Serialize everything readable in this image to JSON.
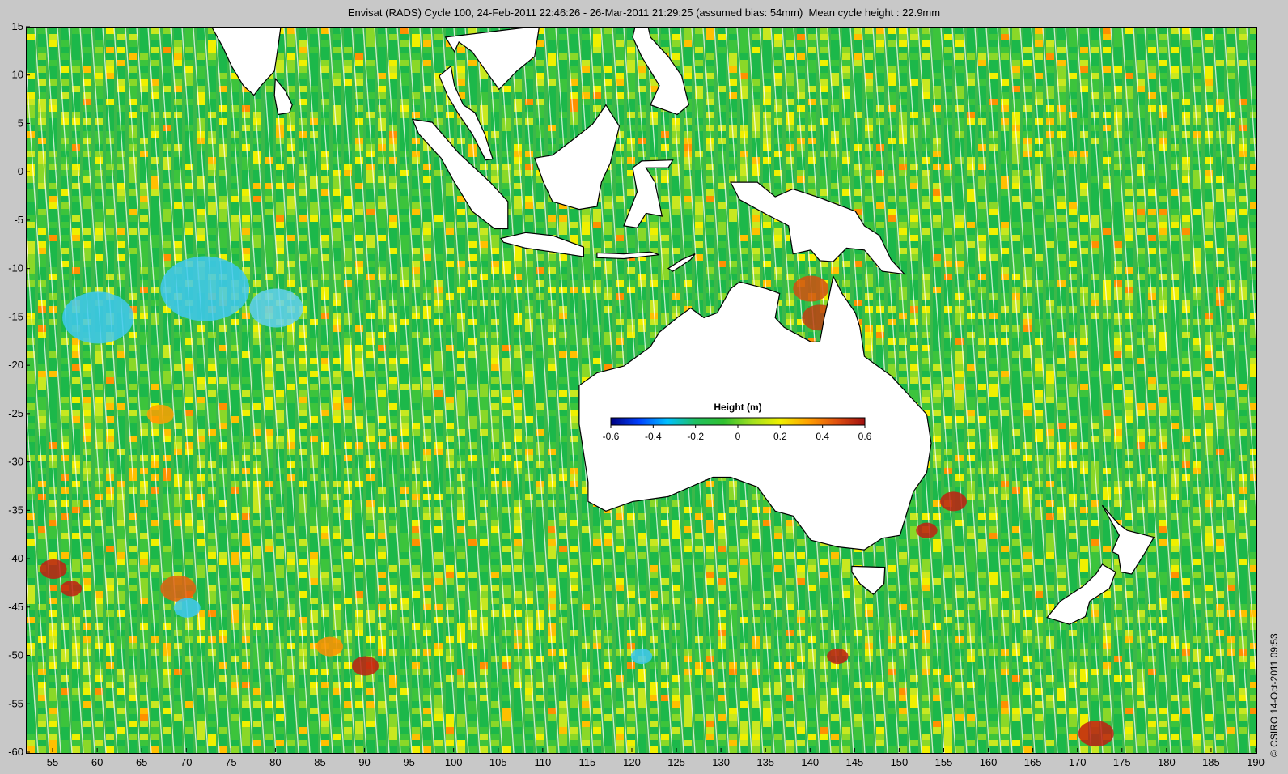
{
  "title": "Envisat (RADS) Cycle 100, 24-Feb-2011 22:46:26 - 26-Mar-2011 21:29:25 (assumed bias: 54mm)  Mean cycle height : 22.9mm",
  "copyright": "© CSIRO 14-Oct-2011 09:53",
  "axes": {
    "lon_min": 52,
    "lon_max": 190,
    "lat_min": -60,
    "lat_max": 15,
    "x_ticks": [
      55,
      60,
      65,
      70,
      75,
      80,
      85,
      90,
      95,
      100,
      105,
      110,
      115,
      120,
      125,
      130,
      135,
      140,
      145,
      150,
      155,
      160,
      165,
      170,
      175,
      180,
      185,
      190
    ],
    "y_ticks": [
      15,
      10,
      5,
      0,
      -5,
      -10,
      -15,
      -20,
      -25,
      -30,
      -35,
      -40,
      -45,
      -50,
      -55,
      -60
    ]
  },
  "colorbar": {
    "title": "Height (m)",
    "min": -0.6,
    "max": 0.6,
    "ticks": [
      "-0.6",
      "-0.4",
      "-0.2",
      "0",
      "0.2",
      "0.4",
      "0.6"
    ],
    "colors": [
      "#000080",
      "#0040ff",
      "#00c0ff",
      "#20c060",
      "#30c030",
      "#a0e020",
      "#f0f000",
      "#ffa000",
      "#e05010",
      "#a01010"
    ]
  },
  "legend_colors": {
    "ocean_base": "#3cb84a",
    "land": "#ffffff",
    "coast": "#000000"
  }
}
